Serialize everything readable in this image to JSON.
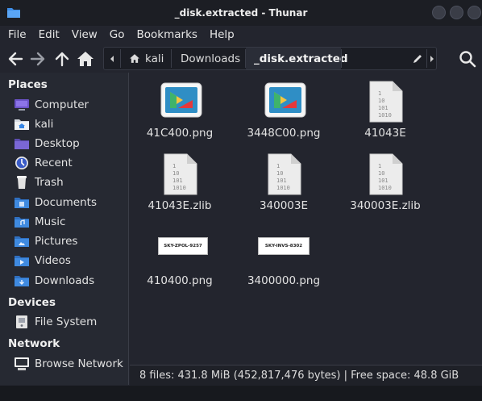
{
  "window": {
    "title": "_disk.extracted - Thunar"
  },
  "menu": [
    "File",
    "Edit",
    "View",
    "Go",
    "Bookmarks",
    "Help"
  ],
  "pathbar": {
    "home": "kali",
    "segments": [
      "Downloads",
      "_disk.extracted"
    ]
  },
  "sidebar": {
    "places_heading": "Places",
    "places": [
      {
        "label": "Computer",
        "icon": "computer-icon"
      },
      {
        "label": "kali",
        "icon": "home-folder-icon"
      },
      {
        "label": "Desktop",
        "icon": "desktop-icon"
      },
      {
        "label": "Recent",
        "icon": "recent-icon"
      },
      {
        "label": "Trash",
        "icon": "trash-icon"
      },
      {
        "label": "Documents",
        "icon": "documents-folder-icon"
      },
      {
        "label": "Music",
        "icon": "music-folder-icon"
      },
      {
        "label": "Pictures",
        "icon": "pictures-folder-icon"
      },
      {
        "label": "Videos",
        "icon": "videos-folder-icon"
      },
      {
        "label": "Downloads",
        "icon": "downloads-folder-icon"
      }
    ],
    "devices_heading": "Devices",
    "devices": [
      {
        "label": "File System",
        "icon": "drive-icon"
      }
    ],
    "network_heading": "Network",
    "network": [
      {
        "label": "Browse Network",
        "icon": "network-icon"
      }
    ]
  },
  "files": [
    {
      "name": "41C400.png",
      "type": "image-icon"
    },
    {
      "name": "3448C00.png",
      "type": "image-icon"
    },
    {
      "name": "41043E",
      "type": "binary-file-icon"
    },
    {
      "name": "41043E.zlib",
      "type": "binary-file-icon"
    },
    {
      "name": "340003E",
      "type": "binary-file-icon"
    },
    {
      "name": "340003E.zlib",
      "type": "binary-file-icon"
    },
    {
      "name": "410400.png",
      "type": "image-thumbnail",
      "thumb_text": "SKY-ZPOL-9257"
    },
    {
      "name": "3400000.png",
      "type": "image-thumbnail",
      "thumb_text": "SKY-INVS-8302"
    }
  ],
  "binary_glyph": [
    "1",
    "10",
    "101",
    "1010"
  ],
  "status": "8 files: 431.8 MiB (452,817,476 bytes) | Free space: 48.8 GiB",
  "colors": {
    "accent": "#3584e4",
    "background": "#23252e",
    "sidebar": "#262932"
  }
}
